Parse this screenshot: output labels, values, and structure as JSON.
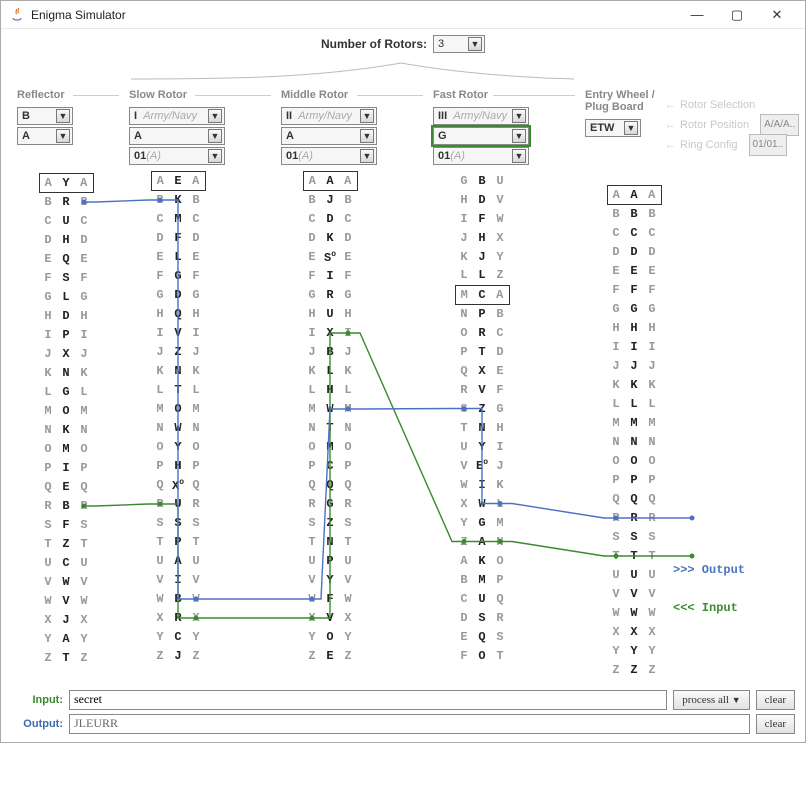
{
  "window": {
    "title": "Enigma Simulator"
  },
  "top": {
    "label": "Number of Rotors:",
    "value": "3"
  },
  "columns": {
    "reflector": {
      "title": "Reflector",
      "sel1": "B",
      "sel2": "A"
    },
    "slow": {
      "title": "Slow Rotor",
      "rotor": "I",
      "model": "Army/Navy",
      "pos": "A",
      "ring": "01",
      "ringA": "(A)"
    },
    "middle": {
      "title": "Middle Rotor",
      "rotor": "II",
      "model": "Army/Navy",
      "pos": "A",
      "ring": "01",
      "ringA": "(A)"
    },
    "fast": {
      "title": "Fast Rotor",
      "rotor": "III",
      "model": "Army/Navy",
      "pos": "G",
      "ring": "01",
      "ringA": "(A)"
    },
    "entry": {
      "title": "Entry Wheel /",
      "title2": "Plug Board",
      "sel": "ETW"
    }
  },
  "rightlabels": {
    "rotor_sel": "Rotor Selection",
    "rotor_pos": "Rotor Position",
    "ring_cfg": "Ring Config",
    "tag_pos": "A/A/A..",
    "tag_ring": "01/01.."
  },
  "annotations": {
    "output": ">>> Output",
    "input": "<<< Input"
  },
  "bottom": {
    "input_label": "Input:",
    "input_value": "secret",
    "output_label": "Output:",
    "output_value": "JLEURR",
    "process": "process all",
    "clear": "clear"
  },
  "letters": [
    "A",
    "B",
    "C",
    "D",
    "E",
    "F",
    "G",
    "H",
    "I",
    "J",
    "K",
    "L",
    "M",
    "N",
    "O",
    "P",
    "Q",
    "R",
    "S",
    "T",
    "U",
    "V",
    "W",
    "X",
    "Y",
    "Z"
  ],
  "reflector_mid": [
    "Y",
    "R",
    "U",
    "H",
    "Q",
    "S",
    "L",
    "D",
    "P",
    "X",
    "N",
    "G",
    "O",
    "K",
    "M",
    "I",
    "E",
    "B",
    "F",
    "Z",
    "C",
    "W",
    "V",
    "J",
    "A",
    "T"
  ],
  "slow_mid": [
    "E",
    "K",
    "M",
    "F",
    "L",
    "G",
    "D",
    "Q",
    "V",
    "Z",
    "N",
    "T",
    "O",
    "W",
    "Y",
    "H",
    "X",
    "U",
    "S",
    "P",
    "A",
    "I",
    "B",
    "R",
    "C",
    "J"
  ],
  "slow_notch": "Q",
  "middle_mid": [
    "A",
    "J",
    "D",
    "K",
    "S",
    "I",
    "R",
    "U",
    "X",
    "B",
    "L",
    "H",
    "W",
    "T",
    "M",
    "C",
    "Q",
    "G",
    "Z",
    "N",
    "P",
    "Y",
    "F",
    "V",
    "O",
    "E"
  ],
  "middle_notch": "E",
  "fast_left": [
    "G",
    "H",
    "I",
    "J",
    "K",
    "L",
    "M",
    "N",
    "O",
    "P",
    "Q",
    "R",
    "S",
    "T",
    "U",
    "V",
    "W",
    "X",
    "Y",
    "Z",
    "A",
    "B",
    "C",
    "D",
    "E",
    "F"
  ],
  "fast_mid": [
    "B",
    "D",
    "F",
    "H",
    "J",
    "L",
    "C",
    "P",
    "R",
    "T",
    "X",
    "V",
    "Z",
    "N",
    "Y",
    "E",
    "I",
    "W",
    "G",
    "A",
    "K",
    "M",
    "U",
    "S",
    "Q",
    "O"
  ],
  "fast_right": [
    "U",
    "V",
    "W",
    "X",
    "Y",
    "Z",
    "A",
    "B",
    "C",
    "D",
    "E",
    "F",
    "G",
    "H",
    "I",
    "J",
    "K",
    "L",
    "M",
    "N",
    "O",
    "P",
    "Q",
    "R",
    "S",
    "T"
  ],
  "fast_notch": "V",
  "entry_mid": [
    "A",
    "B",
    "C",
    "D",
    "E",
    "F",
    "G",
    "H",
    "I",
    "J",
    "K",
    "L",
    "M",
    "N",
    "O",
    "P",
    "Q",
    "R",
    "S",
    "T",
    "U",
    "V",
    "W",
    "X",
    "Y",
    "Z"
  ],
  "chart_data": {
    "type": "table",
    "title": "Enigma rotor wiring state",
    "rotors": [
      {
        "name": "Reflector",
        "type": "B",
        "position": "A",
        "wiring": [
          "Y",
          "R",
          "U",
          "H",
          "Q",
          "S",
          "L",
          "D",
          "P",
          "X",
          "N",
          "G",
          "O",
          "K",
          "M",
          "I",
          "E",
          "B",
          "F",
          "Z",
          "C",
          "W",
          "V",
          "J",
          "A",
          "T"
        ]
      },
      {
        "name": "Slow",
        "type": "I",
        "model": "Army/Navy",
        "position": "A",
        "ring": "01",
        "wiring": [
          "E",
          "K",
          "M",
          "F",
          "L",
          "G",
          "D",
          "Q",
          "V",
          "Z",
          "N",
          "T",
          "O",
          "W",
          "Y",
          "H",
          "X",
          "U",
          "S",
          "P",
          "A",
          "I",
          "B",
          "R",
          "C",
          "J"
        ],
        "notch": "Q"
      },
      {
        "name": "Middle",
        "type": "II",
        "model": "Army/Navy",
        "position": "A",
        "ring": "01",
        "wiring": [
          "A",
          "J",
          "D",
          "K",
          "S",
          "I",
          "R",
          "U",
          "X",
          "B",
          "L",
          "H",
          "W",
          "T",
          "M",
          "C",
          "Q",
          "G",
          "Z",
          "N",
          "P",
          "Y",
          "F",
          "V",
          "O",
          "E"
        ],
        "notch": "E"
      },
      {
        "name": "Fast",
        "type": "III",
        "model": "Army/Navy",
        "position": "G",
        "ring": "01",
        "left": [
          "G",
          "H",
          "I",
          "J",
          "K",
          "L",
          "M",
          "N",
          "O",
          "P",
          "Q",
          "R",
          "S",
          "T",
          "U",
          "V",
          "W",
          "X",
          "Y",
          "Z",
          "A",
          "B",
          "C",
          "D",
          "E",
          "F"
        ],
        "wiring": [
          "B",
          "D",
          "F",
          "H",
          "J",
          "L",
          "C",
          "P",
          "R",
          "T",
          "X",
          "V",
          "Z",
          "N",
          "Y",
          "E",
          "I",
          "W",
          "G",
          "A",
          "K",
          "M",
          "U",
          "S",
          "Q",
          "O"
        ],
        "right": [
          "U",
          "V",
          "W",
          "X",
          "Y",
          "Z",
          "A",
          "B",
          "C",
          "D",
          "E",
          "F",
          "G",
          "H",
          "I",
          "J",
          "K",
          "L",
          "M",
          "N",
          "O",
          "P",
          "Q",
          "R",
          "S",
          "T"
        ],
        "notch": "V"
      },
      {
        "name": "EntryWheel",
        "type": "ETW",
        "wiring": [
          "A",
          "B",
          "C",
          "D",
          "E",
          "F",
          "G",
          "H",
          "I",
          "J",
          "K",
          "L",
          "M",
          "N",
          "O",
          "P",
          "Q",
          "R",
          "S",
          "T",
          "U",
          "V",
          "W",
          "X",
          "Y",
          "Z"
        ]
      }
    ],
    "path_forward_input_letter": "T",
    "path_output_letter": "R",
    "io": {
      "input": "secret",
      "output": "JLEURR"
    }
  }
}
